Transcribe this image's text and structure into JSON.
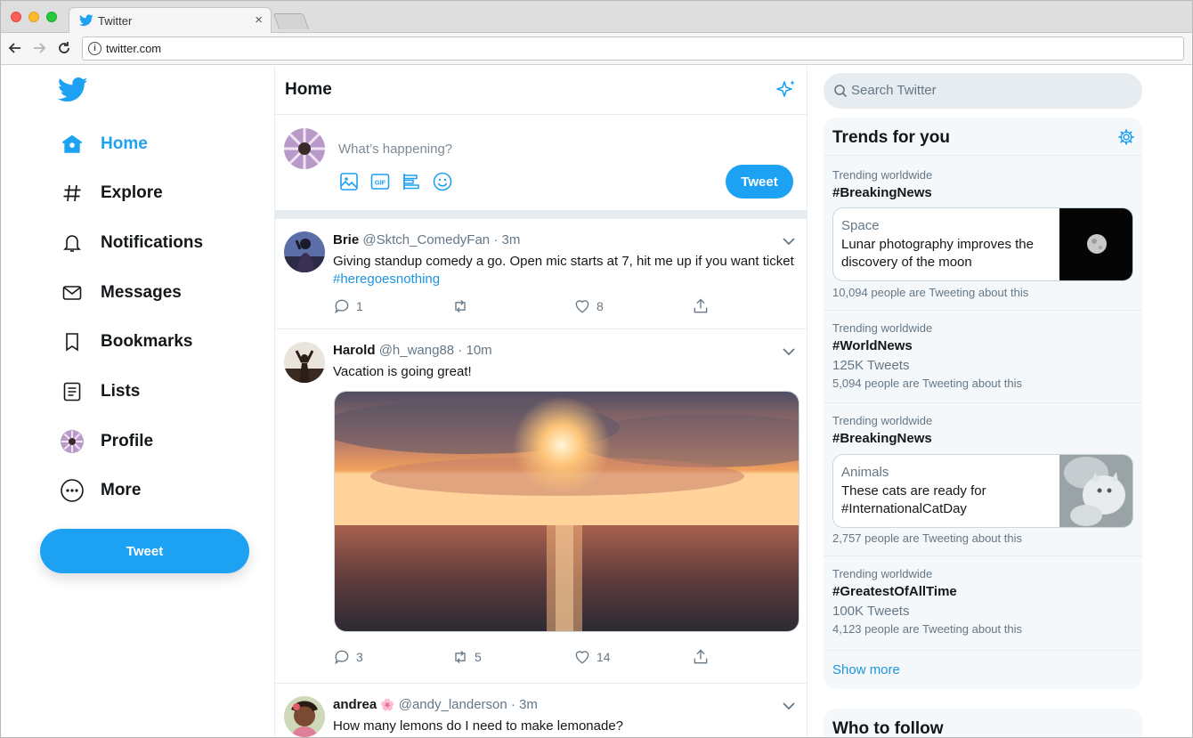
{
  "browser": {
    "tab_title": "Twitter",
    "tab_close": "×",
    "url": "twitter.com",
    "info_glyph": "i"
  },
  "sidebar": {
    "items": [
      {
        "label": "Home",
        "icon": "home-icon"
      },
      {
        "label": "Explore",
        "icon": "hashtag-icon"
      },
      {
        "label": "Notifications",
        "icon": "bell-icon"
      },
      {
        "label": "Messages",
        "icon": "envelope-icon"
      },
      {
        "label": "Bookmarks",
        "icon": "bookmark-icon"
      },
      {
        "label": "Lists",
        "icon": "list-icon"
      },
      {
        "label": "Profile",
        "icon": "avatar"
      },
      {
        "label": "More",
        "icon": "more-icon"
      }
    ],
    "tweet_button": "Tweet"
  },
  "main": {
    "title": "Home",
    "composer": {
      "placeholder": "What’s happening?",
      "tweet_button": "Tweet"
    },
    "tweets": [
      {
        "name": "Brie",
        "handle": "@Sktch_ComedyFan · 3m",
        "text": "Giving standup comedy a go. Open mic starts at 7, hit me up if you want ticket ",
        "hashtag": "#heregoesnothing",
        "replies": "1",
        "retweets": "",
        "likes": "8"
      },
      {
        "name": "Harold",
        "handle": "@h_wang88 · 10m",
        "text": "Vacation is going great!",
        "replies": "3",
        "retweets": "5",
        "likes": "14"
      },
      {
        "name": "andrea",
        "emoji": "🌸",
        "handle": "@andy_landerson · 3m",
        "text": "How many lemons do I need to make lemonade?"
      }
    ]
  },
  "right": {
    "search_placeholder": "Search Twitter",
    "trends_title": "Trends for you",
    "trends": [
      {
        "context": "Trending worldwide",
        "tag": "#BreakingNews",
        "card_category": "Space",
        "card_headline": "Lunar photography improves the discovery of the moon",
        "people": "10,094 people are Tweeting about this"
      },
      {
        "context": "Trending worldwide",
        "tag": "#WorldNews",
        "count": "125K Tweets",
        "people": "5,094 people are Tweeting about this"
      },
      {
        "context": "Trending worldwide",
        "tag": "#BreakingNews",
        "card_category": "Animals",
        "card_headline": "These cats are ready for #InternationalCatDay",
        "people": "2,757 people are Tweeting about this"
      },
      {
        "context": "Trending worldwide",
        "tag": "#GreatestOfAllTime",
        "count": "100K Tweets",
        "people": "4,123 people are Tweeting about this"
      }
    ],
    "show_more": "Show more",
    "who_to_follow": "Who to follow"
  },
  "colors": {
    "accent": "#1da1f2",
    "link": "#1b95e0",
    "text_secondary": "#657786",
    "border": "#e6ecf0"
  }
}
